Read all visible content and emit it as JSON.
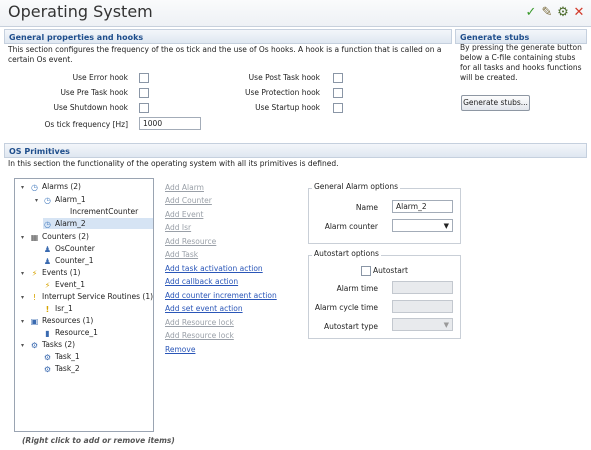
{
  "header": {
    "title": "Operating System",
    "icons": [
      "check-icon",
      "wrench-icon",
      "gear-icon",
      "close-icon"
    ]
  },
  "general": {
    "title": "General properties and hooks",
    "description": "This section configures the frequency of the os tick and the use of Os hooks. A hook is a function that is called on a certain Os event.",
    "hooks_left": [
      "Use Error hook",
      "Use Pre Task hook",
      "Use Shutdown hook"
    ],
    "hooks_right": [
      "Use Post Task hook",
      "Use Protection hook",
      "Use Startup hook"
    ],
    "tick_label": "Os tick frequency [Hz]",
    "tick_value": "1000"
  },
  "stubs": {
    "title": "Generate stubs",
    "description": "By pressing the generate button below a C-file containing stubs for all tasks and hooks functions will be created.",
    "button": "Generate stubs..."
  },
  "primitives": {
    "title": "OS Primitives",
    "description": "In this section the functionality of the operating system with all its primitives is defined.",
    "tree": [
      {
        "label": "Alarms (2)",
        "icon": "alarm-group-icon"
      },
      {
        "label": "Alarm_1",
        "icon": "alarm-icon"
      },
      {
        "label": "IncrementCounter",
        "icon": ""
      },
      {
        "label": "Alarm_2",
        "icon": "alarm-icon"
      },
      {
        "label": "Counters (2)",
        "icon": "counter-group-icon"
      },
      {
        "label": "OsCounter",
        "icon": "counter-icon"
      },
      {
        "label": "Counter_1",
        "icon": "counter-icon"
      },
      {
        "label": "Events (1)",
        "icon": "event-group-icon"
      },
      {
        "label": "Event_1",
        "icon": "event-icon"
      },
      {
        "label": "Interrupt Service Routines (1)",
        "icon": "isr-group-icon"
      },
      {
        "label": "Isr_1",
        "icon": "isr-icon"
      },
      {
        "label": "Resources (1)",
        "icon": "resource-group-icon"
      },
      {
        "label": "Resource_1",
        "icon": "resource-icon"
      },
      {
        "label": "Tasks (2)",
        "icon": "task-group-icon"
      },
      {
        "label": "Task_1",
        "icon": "task-icon"
      },
      {
        "label": "Task_2",
        "icon": "task-icon"
      }
    ],
    "tree_hint": "(Right click to add or remove items)",
    "actions": [
      {
        "label": "Add Alarm",
        "enabled": false
      },
      {
        "label": "Add Counter",
        "enabled": false
      },
      {
        "label": "Add Event",
        "enabled": false
      },
      {
        "label": "Add Isr",
        "enabled": false
      },
      {
        "label": "Add Resource",
        "enabled": false
      },
      {
        "label": "Add Task",
        "enabled": false
      },
      {
        "label": "Add task activation action",
        "enabled": true
      },
      {
        "label": "Add callback action",
        "enabled": true
      },
      {
        "label": "Add counter increment action",
        "enabled": true
      },
      {
        "label": "Add set event action",
        "enabled": true
      },
      {
        "label": "Add Resource lock",
        "enabled": false
      },
      {
        "label": "Add Resource lock",
        "enabled": false
      },
      {
        "label": "Remove",
        "enabled": true
      }
    ],
    "alarm_options": {
      "title": "General Alarm options",
      "name_label": "Name",
      "name_value": "Alarm_2",
      "counter_label": "Alarm counter",
      "counter_value": ""
    },
    "autostart": {
      "title": "Autostart options",
      "checkbox_label": "Autostart",
      "time_label": "Alarm time",
      "cycle_label": "Alarm cycle time",
      "type_label": "Autostart type"
    }
  },
  "colors": {
    "link": "#2a56b8",
    "disabled_link": "#9aa0a8",
    "section_title": "#1f4e8c"
  }
}
